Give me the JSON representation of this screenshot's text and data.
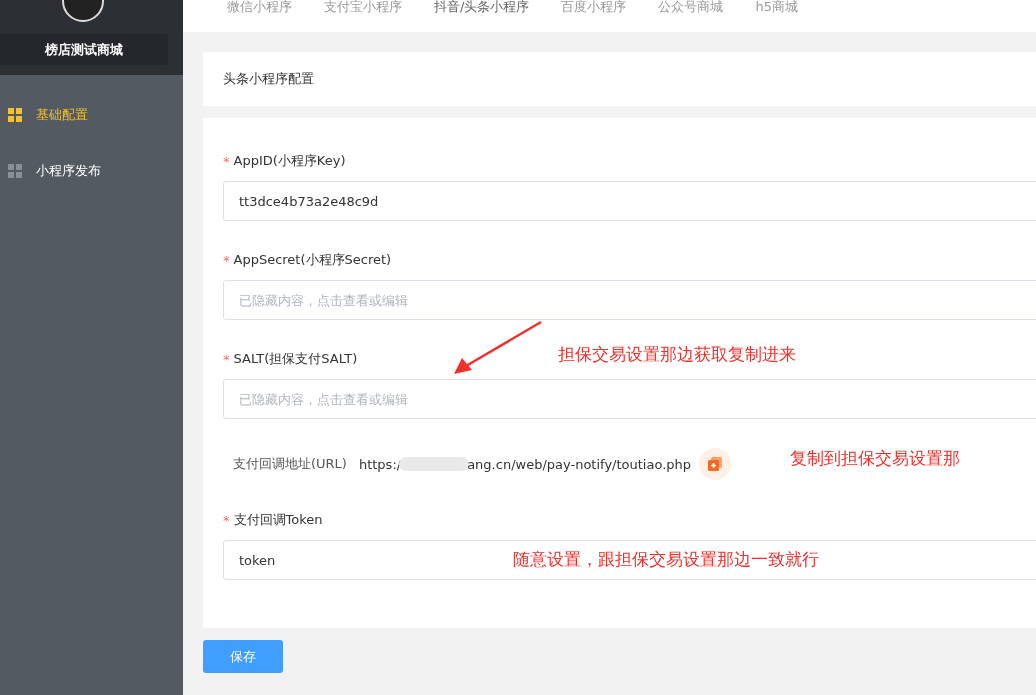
{
  "sidebar": {
    "shop_name": "榜店测试商城",
    "items": [
      {
        "label": "基础配置",
        "selected": true
      },
      {
        "label": "小程序发布",
        "selected": false
      }
    ]
  },
  "tabs": [
    {
      "label": "微信小程序",
      "selected": false
    },
    {
      "label": "支付宝小程序",
      "selected": false
    },
    {
      "label": "抖音/头条小程序",
      "selected": true
    },
    {
      "label": "百度小程序",
      "selected": false
    },
    {
      "label": "公众号商城",
      "selected": false
    },
    {
      "label": "h5商城",
      "selected": false
    }
  ],
  "section_title": "头条小程序配置",
  "fields": [
    {
      "kind": "input",
      "label": "AppID(小程序Key)",
      "required_mark": "*",
      "value": "tt3dce4b73a2e48c9d"
    },
    {
      "kind": "input",
      "label": "AppSecret(小程序Secret)",
      "required_mark": "*",
      "placeholder": "已隐藏内容，点击查看或编辑"
    },
    {
      "kind": "input",
      "label": "SALT(担保支付SALT)",
      "required_mark": "*",
      "placeholder": "已隐藏内容，点击查看或编辑"
    },
    {
      "kind": "url",
      "label": "支付回调地址(URL)",
      "url_start": "https:/",
      "url_end": "ang.cn/web/pay-notify/toutiao.php"
    },
    {
      "kind": "input",
      "label": "支付回调Token",
      "required_mark": "*",
      "value": "token"
    }
  ],
  "save_button": "保存",
  "annotations": [
    {
      "text": "担保交易设置那边获取复制进来"
    },
    {
      "text": "复制到担保交易设置那"
    },
    {
      "text": "随意设置，跟担保交易设置那边一致就行"
    }
  ]
}
